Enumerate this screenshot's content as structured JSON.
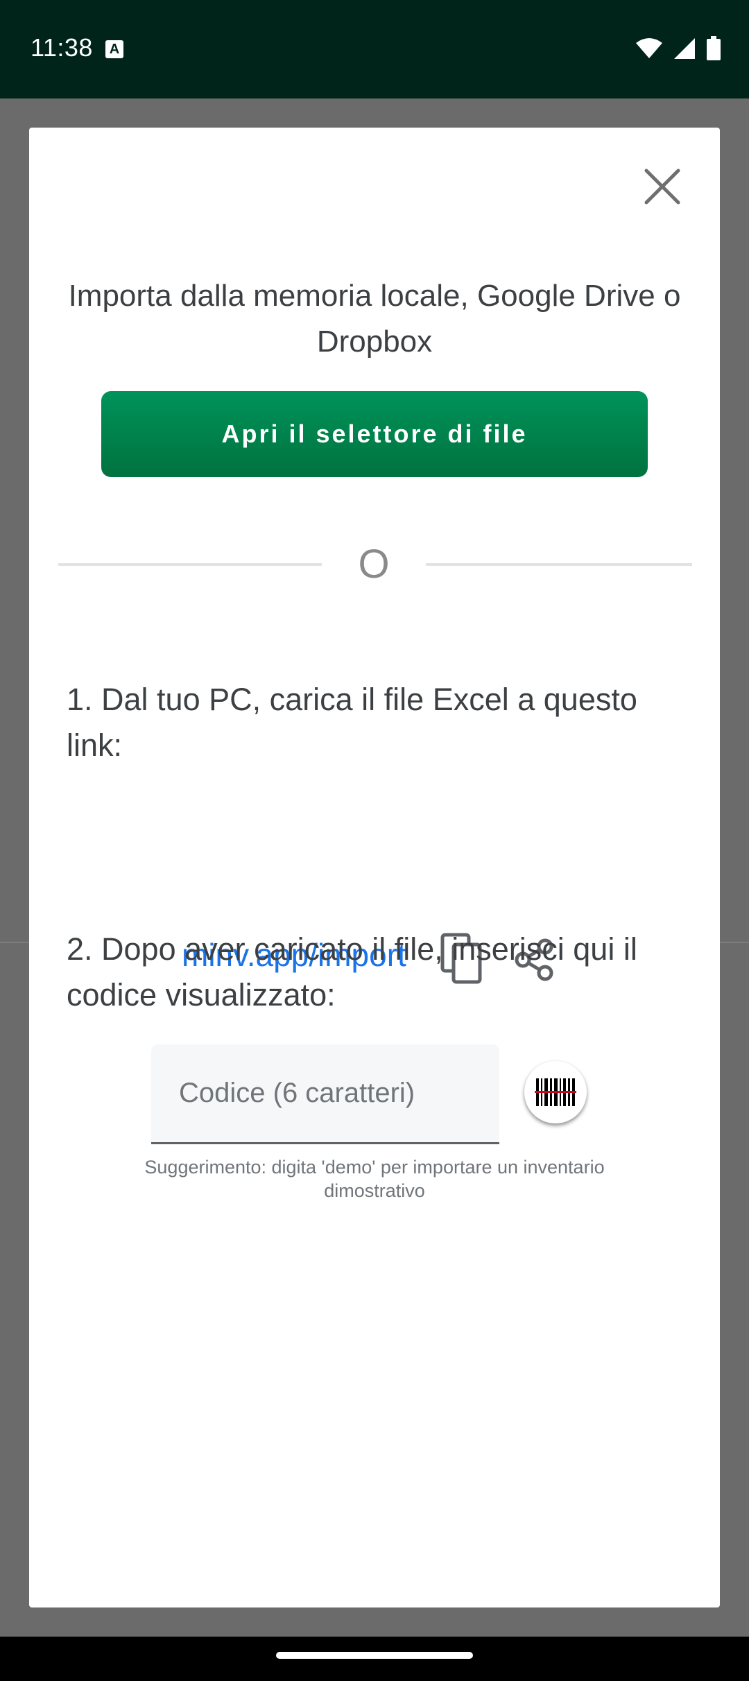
{
  "status_bar": {
    "time": "11:38",
    "notification_icon": "A",
    "icons": [
      "wifi-icon",
      "signal-icon",
      "battery-icon"
    ]
  },
  "dialog": {
    "intro": "Importa dalla memoria locale, Google Drive o Dropbox",
    "open_picker_label": "Apri il selettore di file",
    "divider_label": "O",
    "step1": "1. Dal tuo PC, carica il file Excel a questo link:",
    "import_link": "minv.app/import",
    "step2": "2. Dopo aver caricato il file, inserisci qui il codice visualizzato:",
    "code_placeholder": "Codice (6 caratteri)",
    "code_value": "",
    "hint": "Suggerimento: digita 'demo' per importare un inventario dimostrativo"
  },
  "colors": {
    "primary_green": "#00834c",
    "link_blue": "#1a73e8",
    "status_bar": "#00241a"
  }
}
